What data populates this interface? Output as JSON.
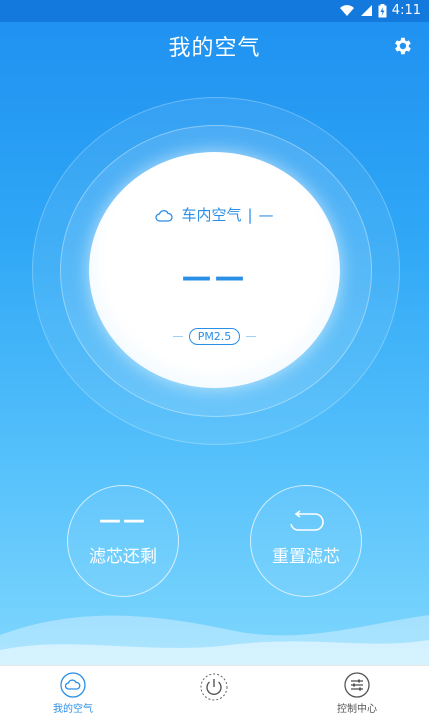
{
  "status_bar": {
    "time": "4:11"
  },
  "header": {
    "title": "我的空气"
  },
  "air": {
    "location_label": "车内空气",
    "separator": "|",
    "level": "—",
    "value": "——",
    "pm_label": "PM2.5"
  },
  "buttons": {
    "filter_remaining_value": "——",
    "filter_remaining_label": "滤芯还剩",
    "reset_filter_label": "重置滤芯"
  },
  "tabs": [
    {
      "label": "我的空气",
      "icon": "cloud-icon",
      "active": true
    },
    {
      "label": "",
      "icon": "power-icon",
      "active": false
    },
    {
      "label": "控制中心",
      "icon": "sliders-icon",
      "active": false
    }
  ],
  "colors": {
    "accent": "#2a8fe6",
    "background_top": "#1e8ff0",
    "background_bottom": "#7fd7fd"
  }
}
